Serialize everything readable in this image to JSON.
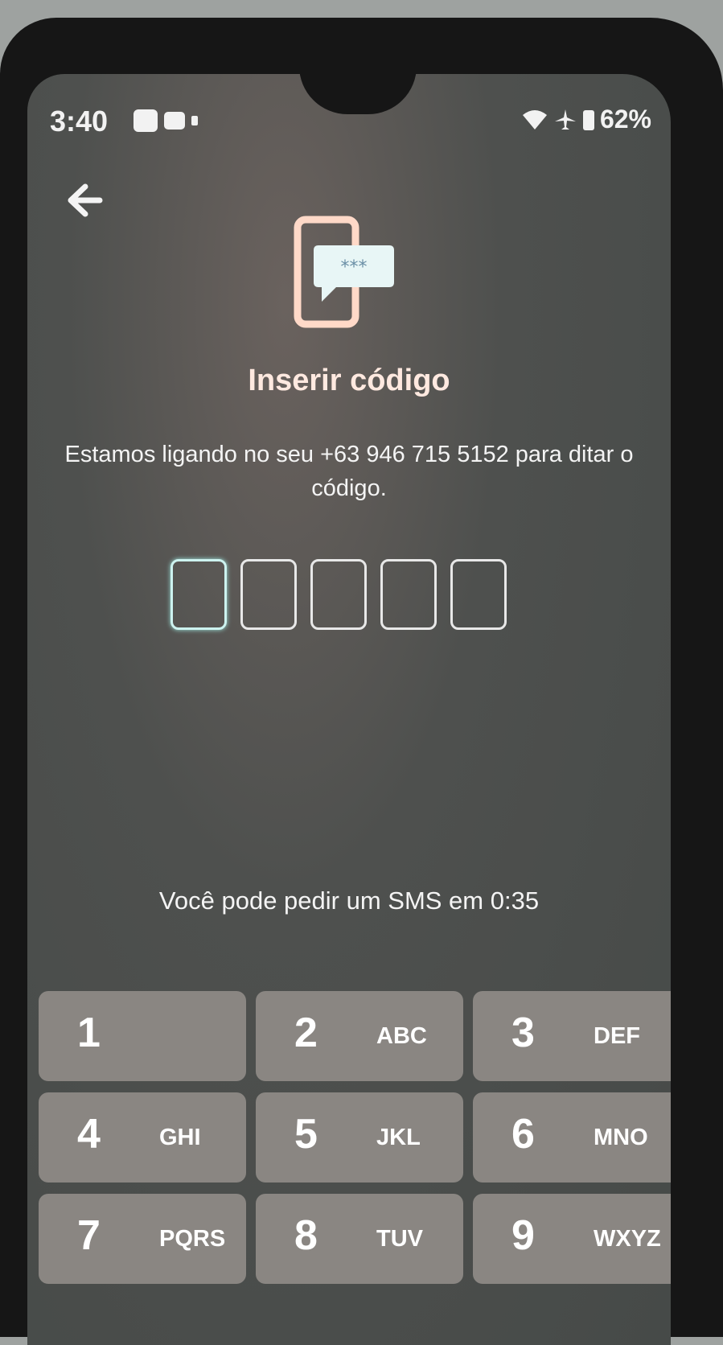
{
  "status_bar": {
    "time": "3:40",
    "battery": "62%",
    "icons": [
      "notification-icon",
      "message-icon",
      "dot-icon",
      "wifi-icon",
      "airplane-icon",
      "battery-icon"
    ]
  },
  "header": {
    "back_icon": "arrow-left-icon",
    "app_icon": "phone-sms-code-icon"
  },
  "main": {
    "title": "Inserir código",
    "description": "Estamos ligando no seu +63 946 715 5152 para ditar o código.",
    "code_length": 5,
    "sms_text": "Você pode pedir um SMS em 0:35"
  },
  "keypad": {
    "keys": [
      {
        "digit": "1",
        "letters": ""
      },
      {
        "digit": "2",
        "letters": "ABC"
      },
      {
        "digit": "3",
        "letters": "DEF"
      },
      {
        "digit": "4",
        "letters": "GHI"
      },
      {
        "digit": "5",
        "letters": "JKL"
      },
      {
        "digit": "6",
        "letters": "MNO"
      },
      {
        "digit": "7",
        "letters": "PQRS"
      },
      {
        "digit": "8",
        "letters": "TUV"
      },
      {
        "digit": "9",
        "letters": "WXYZ"
      }
    ]
  },
  "colors": {
    "accent": "#cdf3f0",
    "key_background": "#8a8682",
    "screen_background": "#4e504e"
  }
}
